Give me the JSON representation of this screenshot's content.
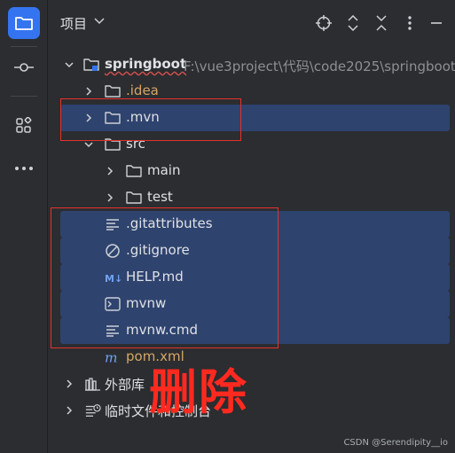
{
  "header": {
    "title": "项目"
  },
  "project": {
    "name": "springboot",
    "path": "F:\\vue3project\\代码\\code2025\\springboot"
  },
  "tree": {
    "idea": ".idea",
    "mvn": ".mvn",
    "src": "src",
    "main": "main",
    "test": "test",
    "gitattributes": ".gitattributes",
    "gitignore": ".gitignore",
    "help": "HELP.md",
    "mvnw": "mvnw",
    "mvnwcmd": "mvnw.cmd",
    "pom": "pom.xml",
    "external": "外部库",
    "scratches": "临时文件和控制台"
  },
  "annotation": {
    "text": "删除"
  },
  "watermark": "CSDN @Serendipity__io",
  "colors": {
    "accent": "#3574f0",
    "selection": "#2e436e",
    "annotation": "#e5322d",
    "folder_excluded": "#d6a766"
  }
}
